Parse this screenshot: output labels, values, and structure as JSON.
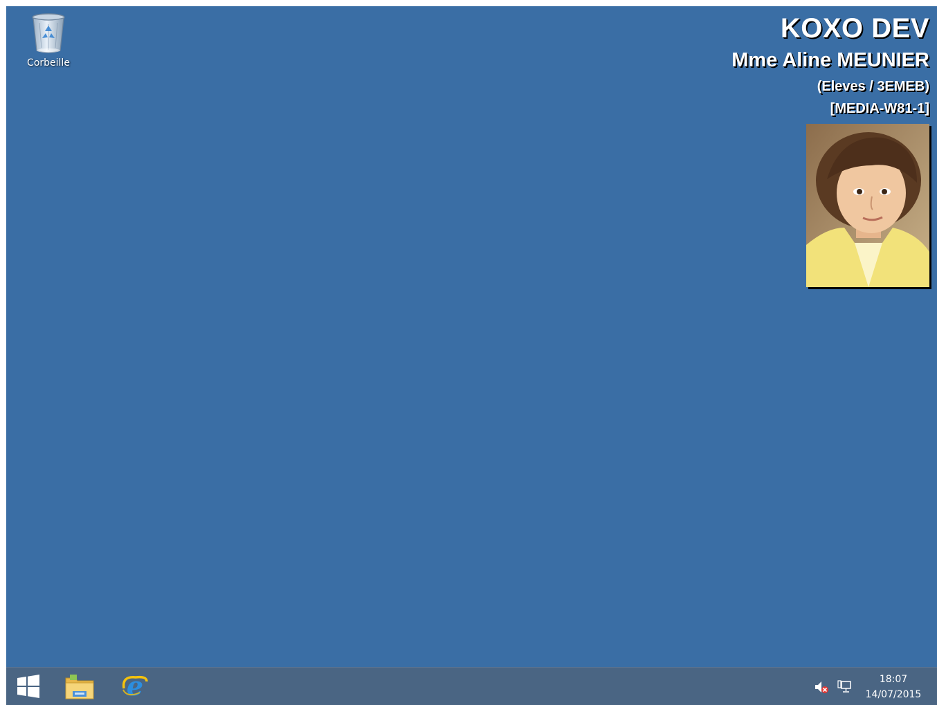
{
  "desktop": {
    "background_color": "#3a6ea5",
    "icons": [
      {
        "label": "Corbeille",
        "icon": "recycle-bin-icon"
      }
    ]
  },
  "info_overlay": {
    "organization": "KOXO DEV",
    "user_name": "Mme Aline MEUNIER",
    "group": "(Eleves / 3EMEB)",
    "machine": "[MEDIA-W81-1]",
    "photo": "user-photo"
  },
  "taskbar": {
    "color": "#4a6583",
    "pinned": [
      {
        "icon": "windows-start-icon"
      },
      {
        "icon": "file-explorer-icon"
      },
      {
        "icon": "internet-explorer-icon"
      }
    ],
    "tray": {
      "icons": [
        "speaker-muted-icon",
        "network-icon"
      ],
      "time": "18:07",
      "date": "14/07/2015"
    }
  }
}
